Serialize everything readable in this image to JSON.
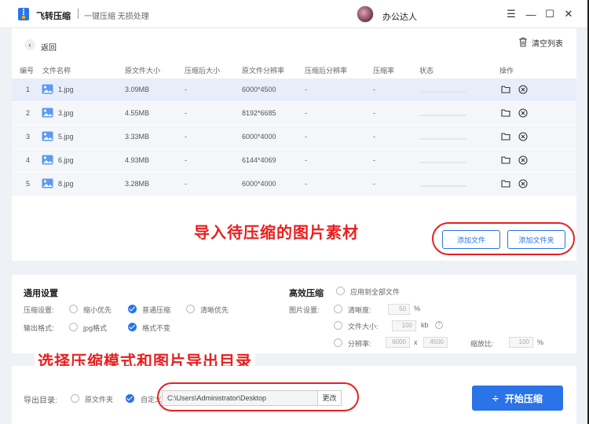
{
  "app": {
    "name": "飞转压缩",
    "slogan": "一键压缩 无损处理"
  },
  "user": {
    "name": "办公达人"
  },
  "window": {
    "menu": "☰",
    "minimize": "—",
    "maximize": "☐",
    "close": "✕"
  },
  "toolbar": {
    "back_label": "返回",
    "clear_label": "清空列表"
  },
  "table": {
    "headers": [
      "编号",
      "文件名称",
      "原文件大小",
      "压缩后大小",
      "原文件分辨率",
      "压缩后分辨率",
      "压缩率",
      "状态",
      "操作"
    ],
    "rows": [
      {
        "no": "1",
        "name": "1.jpg",
        "size": "3.09MB",
        "after": "-",
        "res": "6000*4500",
        "after_res": "-",
        "rate": "-"
      },
      {
        "no": "2",
        "name": "3.jpg",
        "size": "4.55MB",
        "after": "-",
        "res": "8192*6685",
        "after_res": "-",
        "rate": "-"
      },
      {
        "no": "3",
        "name": "5.jpg",
        "size": "3.33MB",
        "after": "-",
        "res": "6000*4000",
        "after_res": "-",
        "rate": "-"
      },
      {
        "no": "4",
        "name": "6.jpg",
        "size": "4.93MB",
        "after": "-",
        "res": "6144*4069",
        "after_res": "-",
        "rate": "-"
      },
      {
        "no": "5",
        "name": "8.jpg",
        "size": "3.28MB",
        "after": "-",
        "res": "6000*4000",
        "after_res": "-",
        "rate": "-"
      }
    ]
  },
  "actions": {
    "add_file": "添加文件",
    "add_folder": "添加文件夹"
  },
  "annotations": {
    "import": "导入待压缩的图片素材",
    "select": "选择压缩模式和图片导出目录"
  },
  "general": {
    "title": "通用设置",
    "compress_label": "压缩设置:",
    "compress_opts": [
      "缩小优先",
      "普通压缩",
      "清晰优先"
    ],
    "output_label": "输出格式:",
    "output_opts": [
      "jpg格式",
      "格式不变"
    ]
  },
  "advanced": {
    "title": "高效压缩",
    "apply_all": "应用到全部文件",
    "image_label": "图片设置:",
    "clarity": "清晰度:",
    "clarity_value": "50",
    "clarity_unit": "%",
    "filesize": "文件大小:",
    "filesize_value": "100",
    "filesize_unit": "kb",
    "info": "?",
    "resolution": "分辨率:",
    "res_w": "6000",
    "res_x": "x",
    "res_h": "4500",
    "scale": "缩放比:",
    "scale_value": "100",
    "scale_unit": "%"
  },
  "export": {
    "label": "导出目录:",
    "opt_source": "原文件夹",
    "opt_custom": "自定义",
    "path": "C:\\Users\\Administrator\\Desktop",
    "change": "更改"
  },
  "start": {
    "icon": "÷",
    "label": "开始压缩"
  },
  "colors": {
    "accent": "#2a73e8",
    "annotation": "#e82020"
  }
}
